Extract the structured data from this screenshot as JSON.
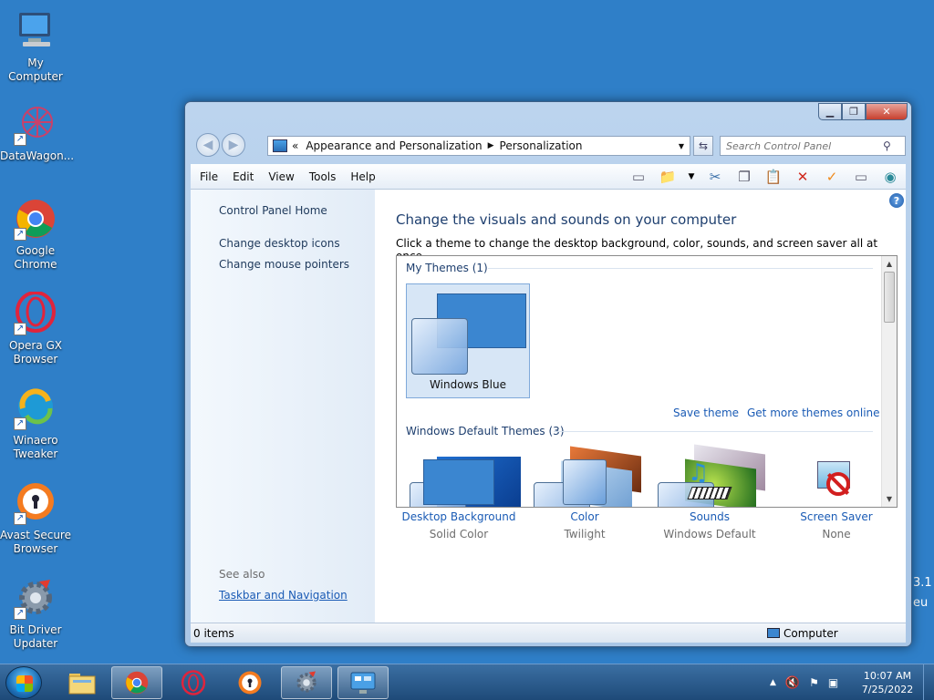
{
  "desktop": {
    "icons": [
      {
        "label": "My Computer"
      },
      {
        "label": "DataWagon..."
      },
      {
        "label": "Google Chrome"
      },
      {
        "label": "Opera GX Browser"
      },
      {
        "label": "Winaero Tweaker"
      },
      {
        "label": "Avast Secure Browser"
      },
      {
        "label": "Bit Driver Updater"
      }
    ],
    "edge_text": [
      "3.1",
      "eu"
    ]
  },
  "window": {
    "controls": {
      "minimize": "▁",
      "maximize": "❐",
      "close": "✕"
    },
    "address": {
      "prefix": "«",
      "crumbs": [
        "Appearance and Personalization",
        "Personalization"
      ]
    },
    "search": {
      "placeholder": "Search Control Panel"
    },
    "menu": [
      "File",
      "Edit",
      "View",
      "Tools",
      "Help"
    ],
    "left_pane": {
      "home": "Control Panel Home",
      "links": [
        "Change desktop icons",
        "Change mouse pointers"
      ],
      "see_also": "See also",
      "see_also_links": [
        "Taskbar and Navigation"
      ]
    },
    "main": {
      "title": "Change the visuals and sounds on your computer",
      "subtitle": "Click a theme to change the desktop background, color, sounds, and screen saver all at once.",
      "my_themes": {
        "header": "My Themes (1)",
        "themes": [
          {
            "name": "Windows Blue"
          }
        ]
      },
      "save_theme": "Save theme",
      "get_more": "Get more themes online",
      "default_themes": {
        "header": "Windows Default Themes (3)"
      },
      "bottom": [
        {
          "name": "Desktop Background",
          "value": "Solid Color"
        },
        {
          "name": "Color",
          "value": "Twilight"
        },
        {
          "name": "Sounds",
          "value": "Windows Default"
        },
        {
          "name": "Screen Saver",
          "value": "None"
        }
      ]
    },
    "status": {
      "items": "0 items",
      "location": "Computer"
    }
  },
  "taskbar": {
    "clock": {
      "time": "10:07 AM",
      "date": "7/25/2022"
    }
  },
  "colors": {
    "desktop": "#2f7fc8",
    "link": "#1a5bb5",
    "heading": "#1e3f6f",
    "theme_blue": "#3b86d0"
  }
}
